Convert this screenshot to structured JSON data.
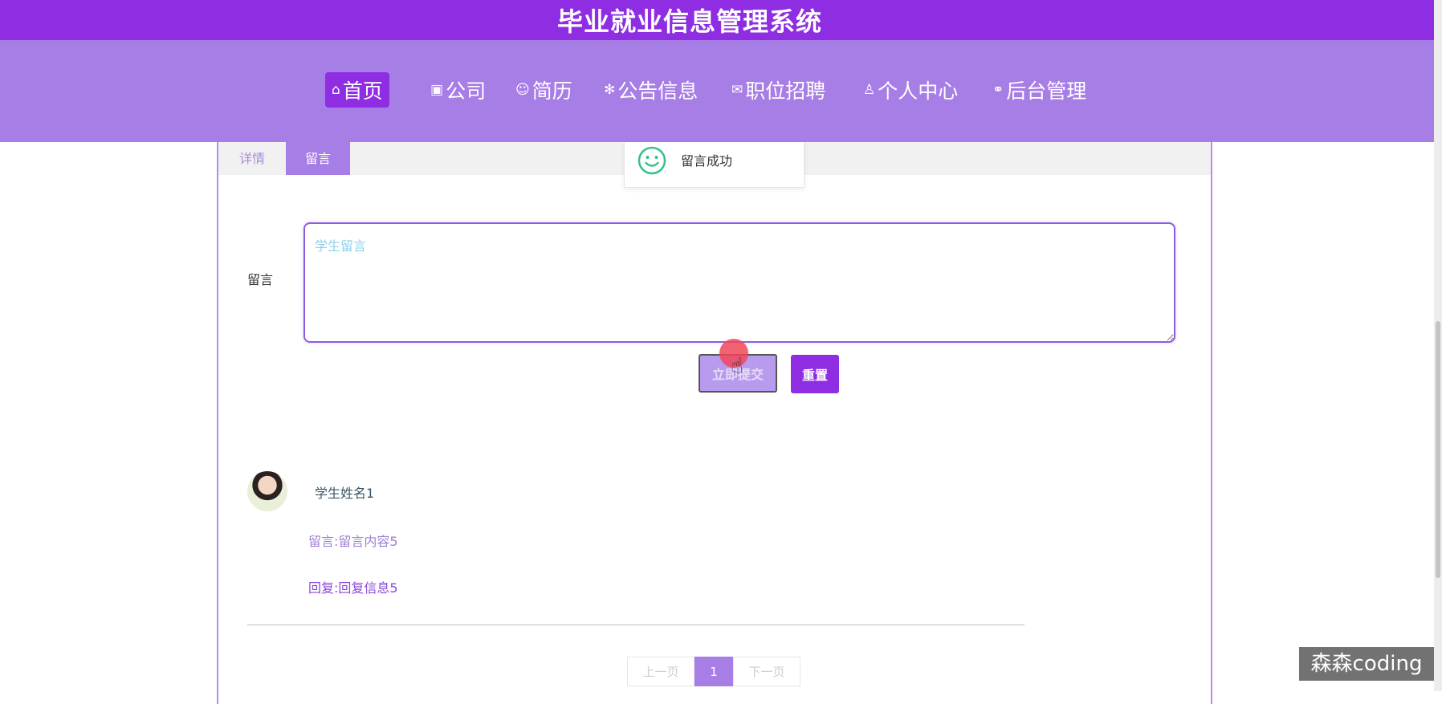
{
  "header": {
    "title": "毕业就业信息管理系统"
  },
  "nav": {
    "items": [
      {
        "icon": "⌂",
        "label": "首页"
      },
      {
        "icon": "▣",
        "label": "公司"
      },
      {
        "icon": "☺",
        "label": "简历"
      },
      {
        "icon": "✻",
        "label": "公告信息"
      },
      {
        "icon": "✉",
        "label": "职位招聘"
      },
      {
        "icon": "♙",
        "label": "个人中心"
      },
      {
        "icon": "⚭",
        "label": "后台管理"
      }
    ]
  },
  "tabs": [
    {
      "label": "详情"
    },
    {
      "label": "留言"
    }
  ],
  "toast": {
    "message": "留言成功"
  },
  "form": {
    "label": "留言",
    "placeholder": "学生留言",
    "value": "",
    "submit_label": "立即提交",
    "reset_label": "重置"
  },
  "comment": {
    "author": "学生姓名1",
    "content": "留言:留言内容5",
    "reply": "回复:回复信息5"
  },
  "pagination": {
    "prev_label": "上一页",
    "current_page": "1",
    "next_label": "下一页"
  },
  "watermark": "森森coding",
  "colors": {
    "primary": "#8e2de2",
    "nav_bg": "#a77de6",
    "success": "#35c28a"
  }
}
